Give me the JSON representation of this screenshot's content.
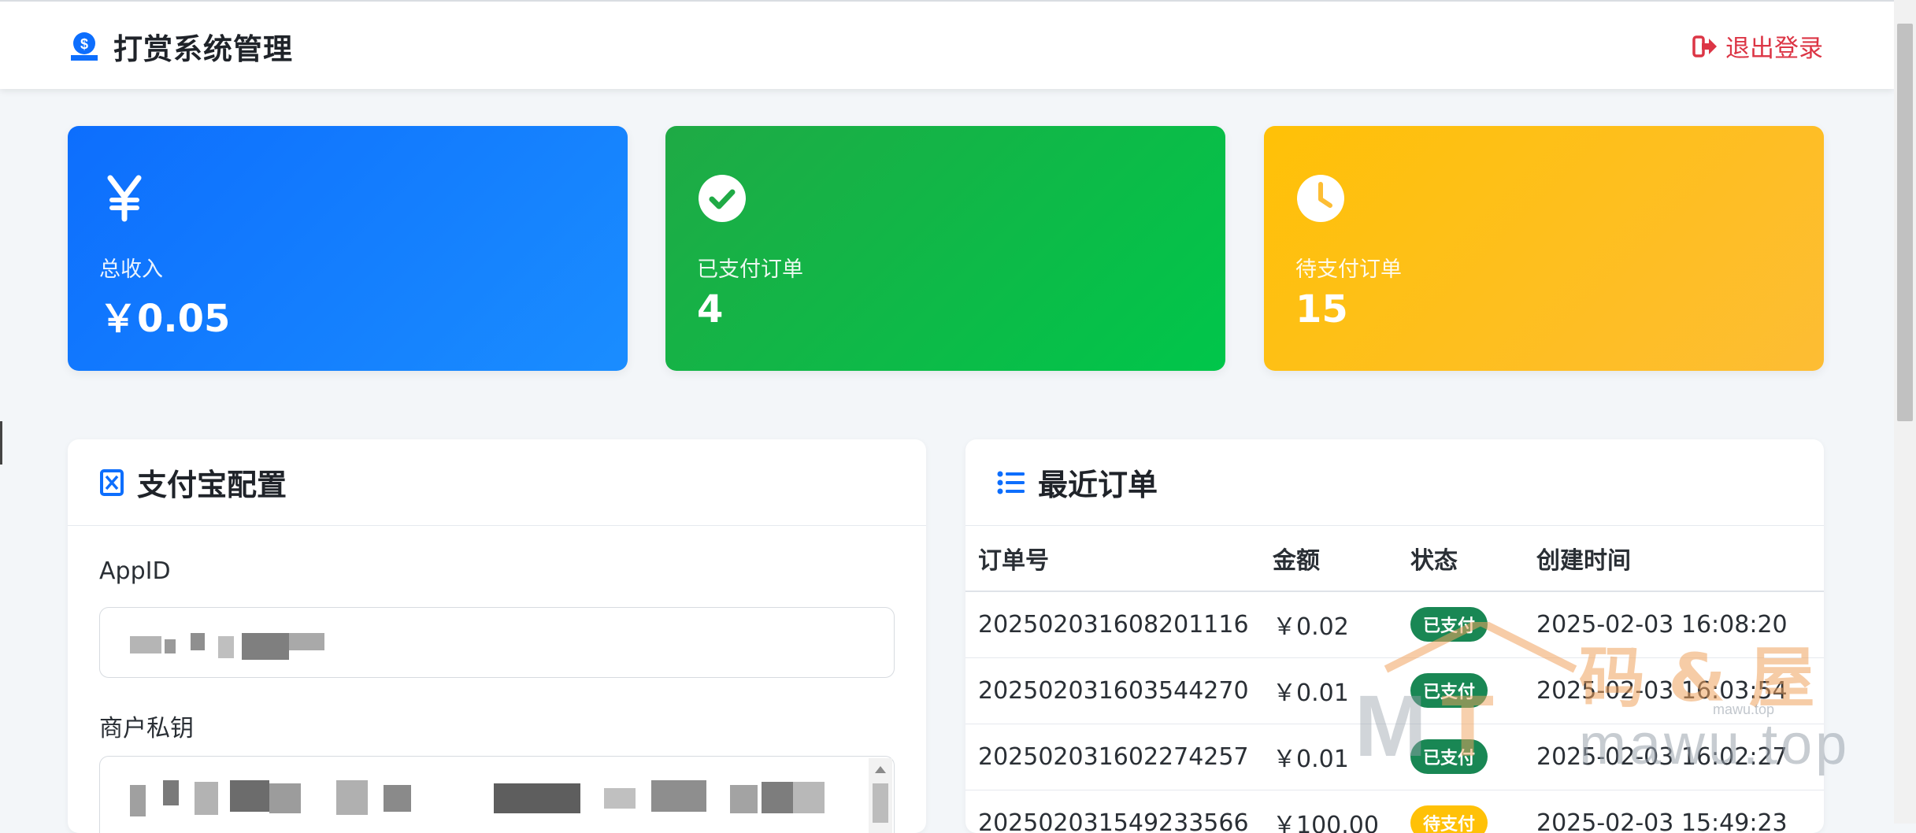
{
  "header": {
    "title": "打赏系统管理",
    "logout_label": "退出登录"
  },
  "stats": [
    {
      "icon": "yen-icon",
      "label": "总收入",
      "value": "￥0.05",
      "color": "#0d6efd"
    },
    {
      "icon": "check-circle-icon",
      "label": "已支付订单",
      "value": "4",
      "color": "#1faa45"
    },
    {
      "icon": "clock-icon",
      "label": "待支付订单",
      "value": "15",
      "color": "#ffc107"
    }
  ],
  "alipay_config": {
    "title": "支付宝配置",
    "appid_label": "AppID",
    "private_key_label": "商户私钥"
  },
  "recent_orders": {
    "title": "最近订单",
    "columns": [
      "订单号",
      "金额",
      "状态",
      "创建时间"
    ],
    "rows": [
      {
        "id": "202502031608201116",
        "amount": "￥0.02",
        "status": "已支付",
        "status_type": "paid",
        "created": "2025-02-03 16:08:20"
      },
      {
        "id": "202502031603544270",
        "amount": "￥0.01",
        "status": "已支付",
        "status_type": "paid",
        "created": "2025-02-03 16:03:54"
      },
      {
        "id": "202502031602274257",
        "amount": "￥0.01",
        "status": "已支付",
        "status_type": "paid",
        "created": "2025-02-03 16:02:27"
      },
      {
        "id": "202502031549233566",
        "amount": "￥100.00",
        "status": "待支付",
        "status_type": "pending",
        "created": "2025-02-03 15:49:23"
      }
    ]
  },
  "watermark": {
    "text_cn": "码 & 屋",
    "text_en": "mawu.top",
    "small": "mawu.top"
  },
  "colors": {
    "primary": "#0d6efd",
    "success": "#198754",
    "warning": "#ffc107",
    "danger": "#dc3545"
  }
}
